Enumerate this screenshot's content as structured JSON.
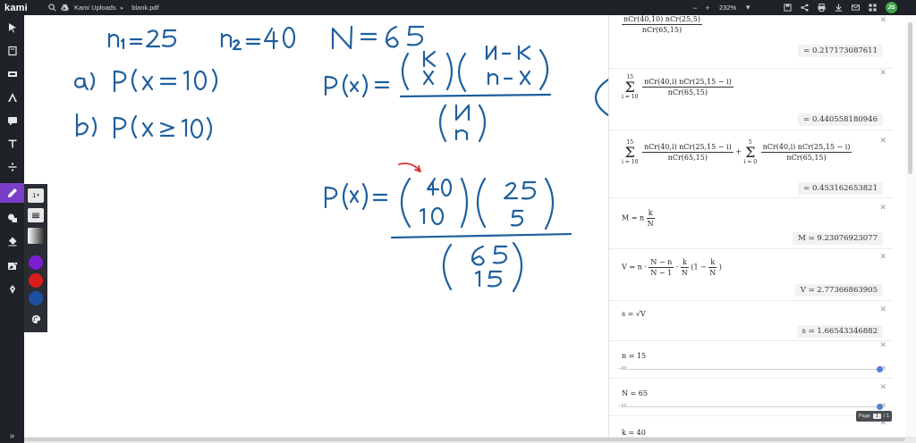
{
  "app": {
    "logo": "kami"
  },
  "breadcrumb": {
    "folder": "Kami Uploads",
    "file": "blank.pdf"
  },
  "zoom": {
    "minus": "−",
    "plus": "+",
    "value": "232%"
  },
  "colors": {
    "toolbar_bg": "#1f2227",
    "accent": "#7a3ec8",
    "ink": "#1f5f9e",
    "red_ink": "#d4312e",
    "avatar": "#3fa34d"
  },
  "user": {
    "initials": "JS"
  },
  "pen": {
    "size": "1"
  },
  "swatches": [
    "#7a1fd6",
    "#d91c1c",
    "#1f4fa0"
  ],
  "calculator": {
    "rows": [
      {
        "expr": "nCr(40,10) nCr(25,5) / nCr(65,15)",
        "result": "= 0.217173087611"
      },
      {
        "expr": "Σ i=10..15 nCr(40,i) nCr(25,15−i) / nCr(65,15)",
        "result": "= 0.440558180946"
      },
      {
        "expr": "Σ i=10..15 … + Σ i=0..5 …",
        "result": "= 0.453162653821"
      },
      {
        "expr": "M = n k/N",
        "result": "M = 9.23076923077"
      },
      {
        "expr": "V = n · (N−n)/(N−1) · k/N (1 − k/N)",
        "result": "V = 2.77366863905"
      },
      {
        "expr": "s = √V",
        "result": "s = 1.66543346882"
      },
      {
        "expr": "n = 15",
        "slider_min": "−10",
        "slider_max": "15",
        "value": 15
      },
      {
        "expr": "N = 65",
        "slider_min": "−10",
        "slider_max": "65",
        "value": 65
      },
      {
        "expr": "k = 40"
      }
    ],
    "sum_lower": "i = 10",
    "sum_upper": "15",
    "sum_lower2": "i = 0",
    "sum_upper2": "5",
    "f1_num": "nCr(40,10) nCr(25,5)",
    "f1_den": "nCr(65,15)",
    "f2_num": "nCr(40,i) nCr(25,15 − i)",
    "f2_den": "nCr(65,15)",
    "m_lhs": "M = n",
    "m_num": "k",
    "m_den": "N",
    "v_lhs": "V = n ·",
    "v_num1": "N − n",
    "v_den1": "N − 1",
    "v_dot": "·",
    "v_num2": "k",
    "v_den2": "N",
    "v_paren": "(1 −",
    "v_close": ")",
    "s_expr": "s = √V",
    "n_expr": "n = 15",
    "N_expr": "N = 65",
    "k_expr": "k = 40",
    "plus": "+"
  },
  "pager": {
    "label": "Page",
    "current": "1",
    "total": "/ 1"
  }
}
